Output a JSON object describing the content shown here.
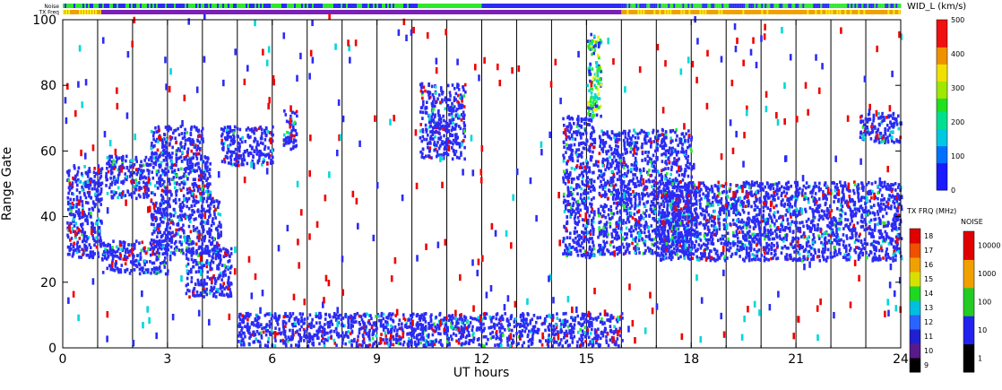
{
  "chart_data": {
    "type": "heatmap",
    "xlabel": "UT hours",
    "ylabel": "Range Gate",
    "xlim": [
      0,
      24
    ],
    "ylim": [
      0,
      100
    ],
    "xticks": [
      "0",
      "3",
      "6",
      "9",
      "12",
      "15",
      "18",
      "21",
      "24"
    ],
    "yticks": [
      "0",
      "20",
      "40",
      "60",
      "80",
      "100"
    ],
    "grid": "vertical lines at 1-hour intervals",
    "top_strips": [
      {
        "label": "Noise",
        "segments": [
          {
            "x0": 0,
            "x1": 10.3,
            "color": "mixed blue/green"
          },
          {
            "x0": 10.3,
            "x1": 12.0,
            "color": "green"
          },
          {
            "x0": 12.0,
            "x1": 16.0,
            "color": "blue"
          },
          {
            "x0": 16.0,
            "x1": 24,
            "color": "mixed blue/green"
          }
        ]
      },
      {
        "label": "TX Freq",
        "segments": [
          {
            "x0": 0,
            "x1": 1.1,
            "color": "orange"
          },
          {
            "x0": 1.1,
            "x1": 16.0,
            "color": "purple"
          },
          {
            "x0": 16.0,
            "x1": 24,
            "color": "orange"
          }
        ]
      }
    ],
    "scatter_bands": [
      {
        "x0": 0.1,
        "x1": 1.1,
        "y0": 27,
        "y1": 55,
        "main": "blue"
      },
      {
        "x0": 1.1,
        "x1": 3.0,
        "y0": 22,
        "y1": 32,
        "main": "blue"
      },
      {
        "x0": 1.2,
        "x1": 4.2,
        "y0": 45,
        "y1": 58,
        "main": "blue"
      },
      {
        "x0": 2.5,
        "x1": 4.5,
        "y0": 28,
        "y1": 45,
        "main": "blue"
      },
      {
        "x0": 3.5,
        "x1": 4.8,
        "y0": 15,
        "y1": 30,
        "main": "blue"
      },
      {
        "x0": 2.5,
        "x1": 4.0,
        "y0": 58,
        "y1": 67,
        "main": "blue"
      },
      {
        "x0": 4.5,
        "x1": 6.0,
        "y0": 55,
        "y1": 67,
        "main": "blue"
      },
      {
        "x0": 6.3,
        "x1": 6.7,
        "y0": 60,
        "y1": 72,
        "main": "blue"
      },
      {
        "x0": 10.2,
        "x1": 11.5,
        "y0": 57,
        "y1": 80,
        "main": "blue"
      },
      {
        "x0": 14.3,
        "x1": 15.2,
        "y0": 27,
        "y1": 70,
        "main": "blue"
      },
      {
        "x0": 15.0,
        "x1": 15.4,
        "y0": 70,
        "y1": 95,
        "main": "green"
      },
      {
        "x0": 15.3,
        "x1": 18.0,
        "y0": 28,
        "y1": 66,
        "main": "blue"
      },
      {
        "x0": 17.0,
        "x1": 24.0,
        "y0": 26,
        "y1": 50,
        "main": "blue"
      },
      {
        "x0": 22.8,
        "x1": 24.0,
        "y0": 62,
        "y1": 71,
        "main": "blue"
      },
      {
        "x0": 5.0,
        "x1": 16.0,
        "y0": 0,
        "y1": 10,
        "main": "blue"
      }
    ],
    "colorbars": [
      {
        "title": "WID_L (km/s)",
        "ticks": [
          "0",
          "100",
          "200",
          "300",
          "400",
          "500"
        ]
      },
      {
        "title": "TX FRQ (MHz)",
        "ticks": [
          "9",
          "10",
          "11",
          "12",
          "13",
          "14",
          "15",
          "16",
          "17",
          "18"
        ]
      },
      {
        "title": "NOISE",
        "ticks": [
          "1",
          "10",
          "100",
          "1000",
          "10000"
        ]
      }
    ]
  },
  "labels": {
    "strip_noise": "Noise",
    "strip_txfreq": "TX Freq",
    "cb1_title": "WID_L (km/s)",
    "cb2_title": "TX FRQ (MHz)",
    "cb3_title": "NOISE"
  },
  "colors": {
    "blue": "#2b2bf5",
    "green": "#2ee82e",
    "purple": "#7a1fb8",
    "orange": "#f0a000",
    "yellow": "#f5f000",
    "red": "#f00000",
    "cyan": "#00d8d8"
  }
}
